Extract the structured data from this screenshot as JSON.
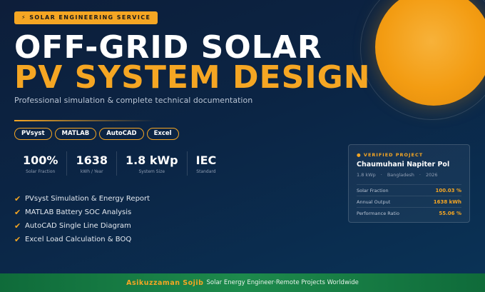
{
  "badge": "⚡ SOLAR ENGINEERING SERVICE",
  "title_line1": "OFF-GRID SOLAR",
  "title_line2": "PV SYSTEM DESIGN",
  "subtitle": "Professional simulation & complete technical documentation",
  "tags": [
    "PVsyst",
    "MATLAB",
    "AutoCAD",
    "Excel"
  ],
  "stats": [
    {
      "value": "100%",
      "label": "Solar Fraction"
    },
    {
      "value": "1638",
      "label": "kWh / Year"
    },
    {
      "value": "1.8 kWp",
      "label": "System Size"
    },
    {
      "value": "IEC",
      "label": "Standard"
    }
  ],
  "check_glyph": "✔",
  "features": [
    "PVsyst Simulation & Energy Report",
    "MATLAB Battery SOC Analysis",
    "AutoCAD Single Line Diagram",
    "Excel Load Calculation & BOQ"
  ],
  "card": {
    "tag": "● VERIFIED PROJECT",
    "title": "Chaumuhani Napiter Pol",
    "meta": [
      "1.8 kWp",
      "·",
      "Bangladesh",
      "·",
      "2026"
    ],
    "rows": [
      {
        "label": "Solar Fraction",
        "value": "100.03 %"
      },
      {
        "label": "Annual Output",
        "value": "1638 kWh"
      },
      {
        "label": "Performance Ratio",
        "value": "55.06 %"
      }
    ]
  },
  "footer": {
    "name": "Asikuzzaman Sojib",
    "text": "Solar Energy Engineer·Remote Projects Worldwide"
  },
  "colors": {
    "accent": "#f5a623",
    "background": "#0b2545",
    "footer": "#1d8a4c"
  }
}
